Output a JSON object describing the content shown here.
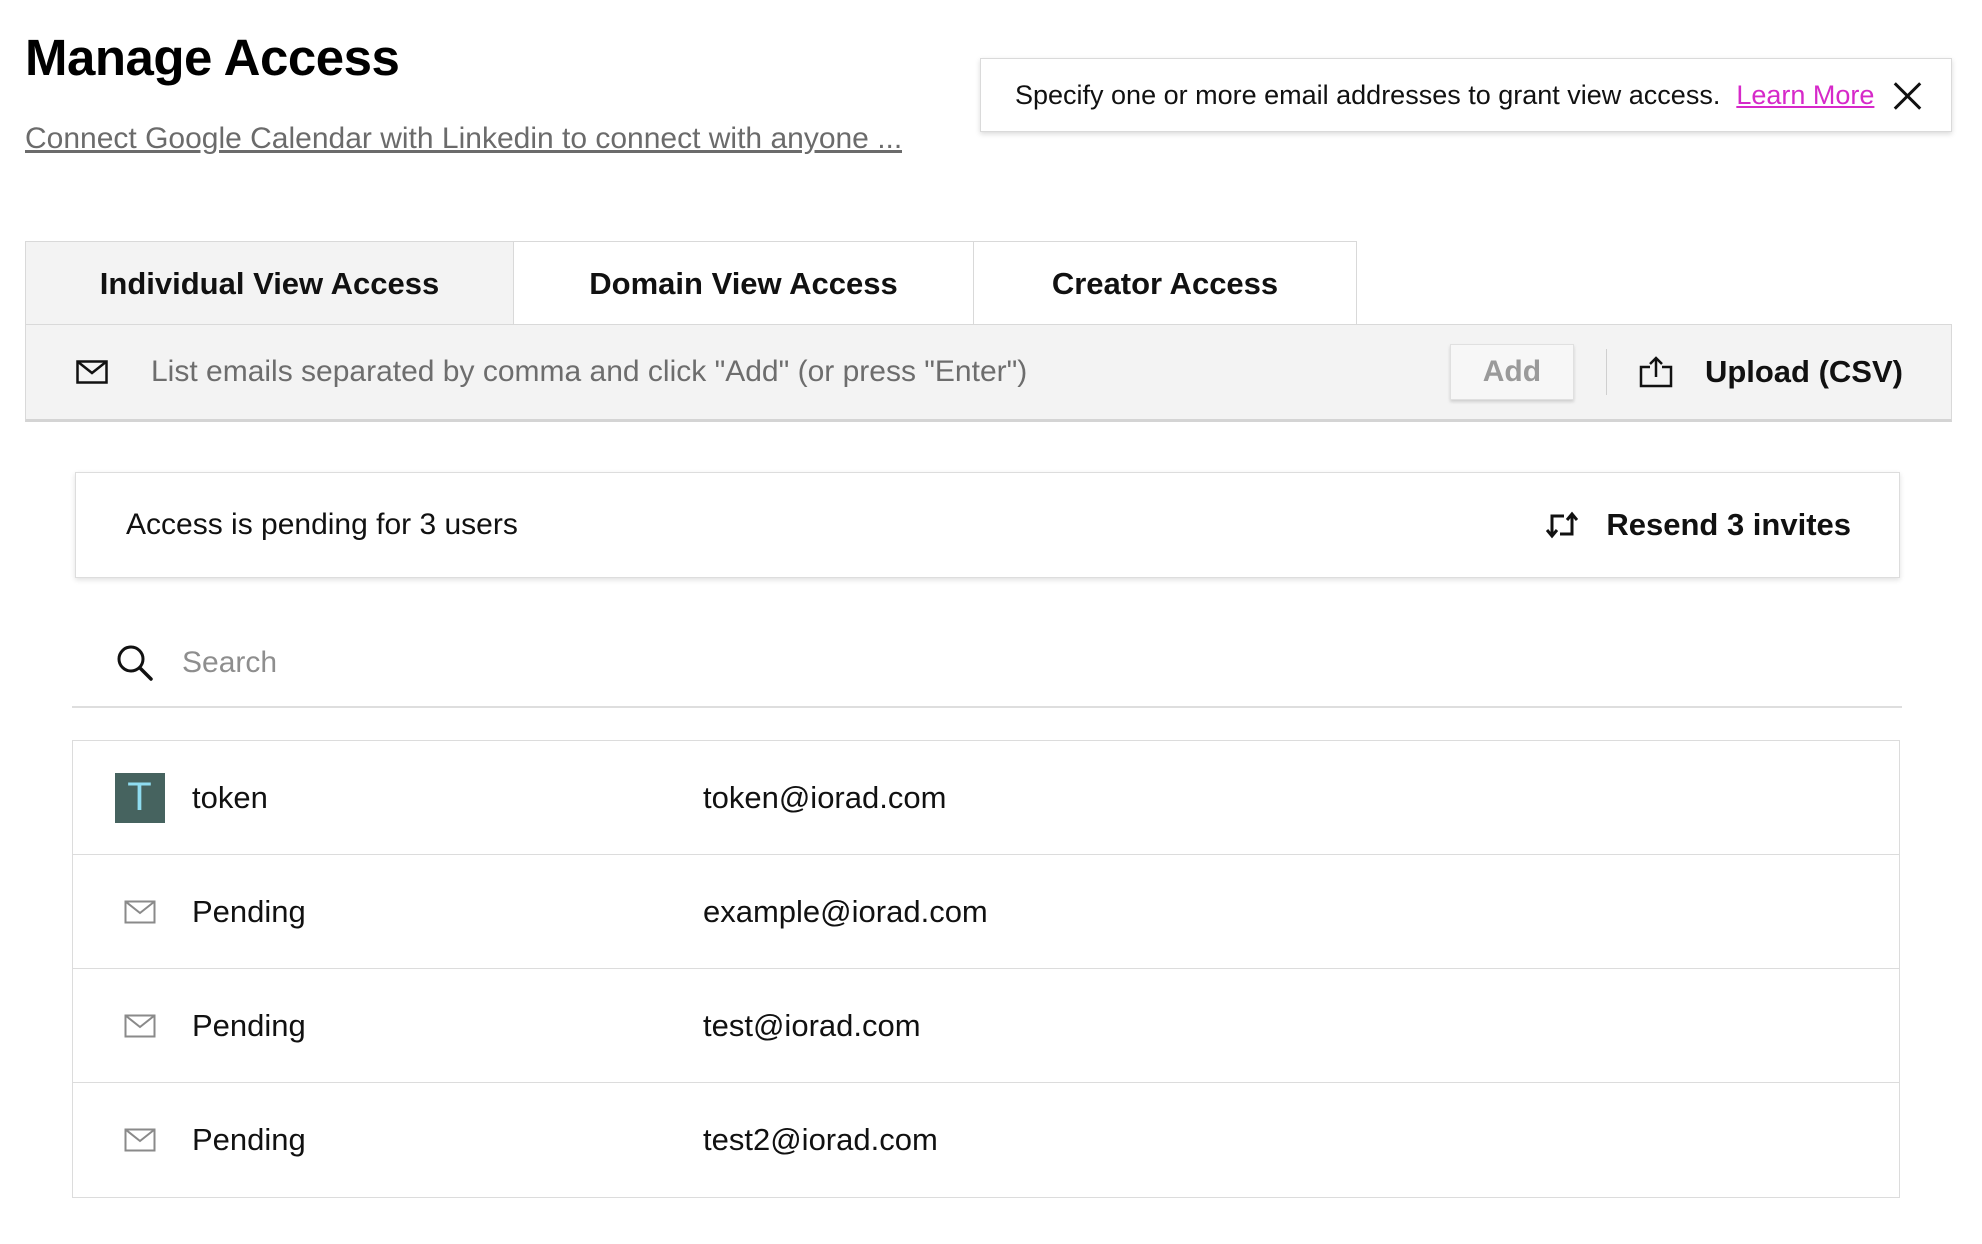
{
  "header": {
    "title": "Manage Access",
    "subtitle_link": "Connect Google Calendar with Linkedin to connect with anyone ..."
  },
  "info_box": {
    "text": "Specify one or more email addresses to grant view access.",
    "link": "Learn More",
    "close_icon": "close-icon"
  },
  "tabs": [
    {
      "label": "Individual View Access",
      "active": true
    },
    {
      "label": "Domain View Access",
      "active": false
    },
    {
      "label": "Creator Access",
      "active": false
    }
  ],
  "email_bar": {
    "icon": "mail-icon",
    "placeholder": "List emails separated by comma and click \"Add\" (or press \"Enter\")",
    "add_label": "Add",
    "upload_icon": "upload-icon",
    "upload_label": "Upload (CSV)"
  },
  "pending": {
    "text": "Access is pending for 3 users",
    "resend_icon": "resend-icon",
    "resend_label": "Resend 3 invites"
  },
  "search": {
    "icon": "search-icon",
    "placeholder": "Search"
  },
  "users": [
    {
      "avatar": "T",
      "name": "token",
      "email": "token@iorad.com"
    },
    {
      "avatar": "",
      "name": "Pending",
      "email": "example@iorad.com"
    },
    {
      "avatar": "",
      "name": "Pending",
      "email": "test@iorad.com"
    },
    {
      "avatar": "",
      "name": "Pending",
      "email": "test2@iorad.com"
    }
  ],
  "colors": {
    "accent_link": "#d629c9",
    "avatar_bg": "#46635f",
    "avatar_fg": "#8fdcf0",
    "bar_bg": "#f3f3f3"
  }
}
